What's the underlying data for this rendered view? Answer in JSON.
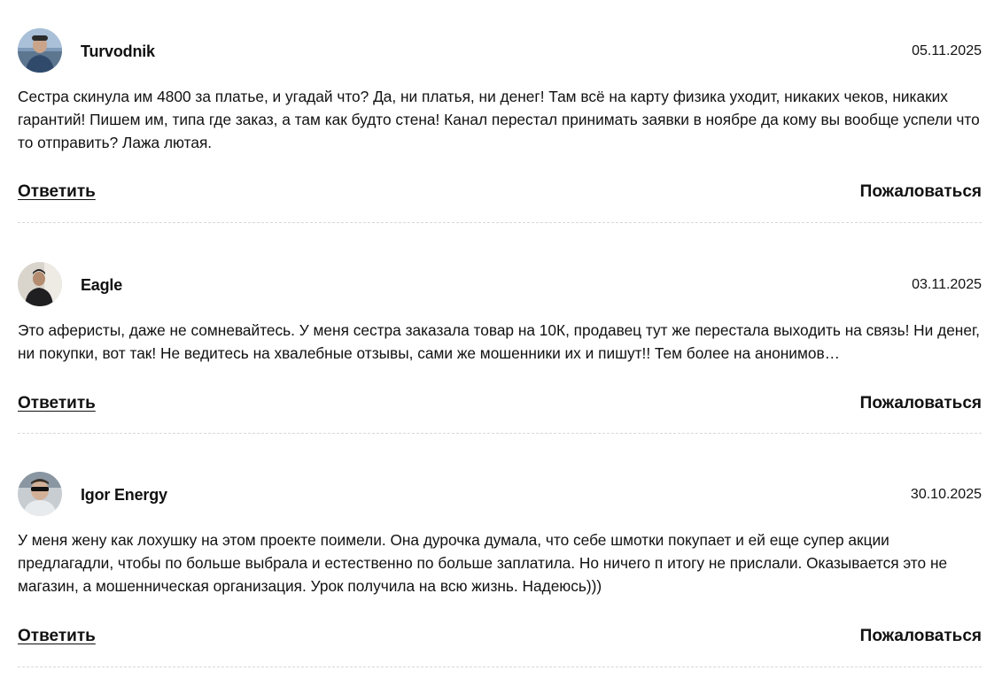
{
  "comments": [
    {
      "username": "Turvodnik",
      "date": "05.11.2025",
      "text": "Сестра скинула им 4800 за платье, и угадай что? Да, ни платья, ни денег! Там всё на карту физика уходит, никаких чеков, никаких гарантий! Пишем им, типа где заказ, а там как будто стена! Канал перестал принимать заявки в ноябре да кому вы вообще успели что то отправить? Лажа лютая.",
      "reply_label": "Ответить",
      "report_label": "Пожаловаться"
    },
    {
      "username": "Eagle",
      "date": "03.11.2025",
      "text": "Это аферисты, даже не сомневайтесь. У меня сестра заказала товар на 10К, продавец тут же перестала выходить на связь! Ни денег, ни покупки, вот так! Не ведитесь на хвалебные отзывы, сами же мошенники их и пишут!! Тем более на анонимов…",
      "reply_label": "Ответить",
      "report_label": "Пожаловаться"
    },
    {
      "username": "Igor Energy",
      "date": "30.10.2025",
      "text": "У меня жену как лохушку на этом проекте поимели. Она дурочка думала, что себе шмотки покупает и ей еще супер акции предлагадли, чтобы по больше выбрала и естественно по больше заплатила. Но ничего п итогу не прислали. Оказывается это не магазин, а мошенническая организация. Урок получила на всю жизнь. Надеюсь)))",
      "reply_label": "Ответить",
      "report_label": "Пожаловаться"
    }
  ]
}
